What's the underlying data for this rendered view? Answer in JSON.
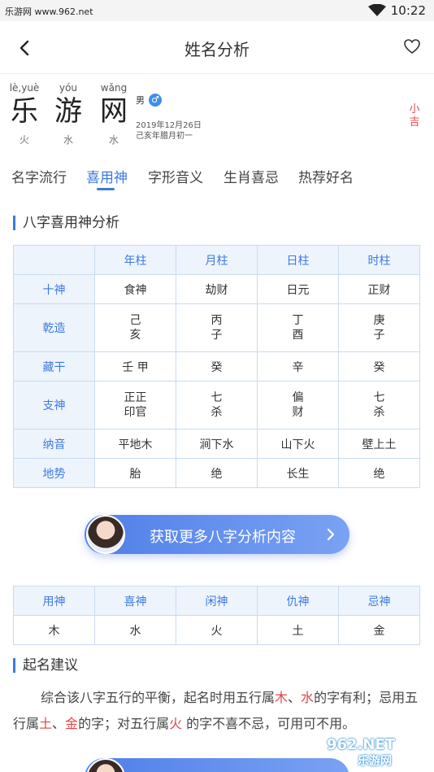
{
  "status_bar": {
    "site": "乐游网 www.962.net",
    "time": "10:22"
  },
  "nav": {
    "title": "姓名分析"
  },
  "name": {
    "chars": [
      {
        "pinyin": "lè,yuè",
        "char": "乐",
        "element": "火"
      },
      {
        "pinyin": "yóu",
        "char": "游",
        "element": "水"
      },
      {
        "pinyin": "wǎng",
        "char": "网",
        "element": "水"
      }
    ],
    "gender": "男",
    "gender_icon": "♂",
    "date_solar": "2019年12月26日",
    "date_lunar": "己亥年腊月初一",
    "luck": "小吉"
  },
  "tabs": [
    {
      "label": "名字流行",
      "active": false
    },
    {
      "label": "喜用神",
      "active": true
    },
    {
      "label": "字形音义",
      "active": false
    },
    {
      "label": "生肖喜忌",
      "active": false
    },
    {
      "label": "热荐好名",
      "active": false
    }
  ],
  "bazi": {
    "section_title": "八字喜用神分析",
    "columns": [
      "",
      "年柱",
      "月柱",
      "日柱",
      "时柱"
    ],
    "rows": [
      {
        "label": "十神",
        "cells": [
          "食神",
          "劫财",
          "日元",
          "正财"
        ]
      },
      {
        "label": "乾造",
        "cells": [
          "己\n亥",
          "丙\n子",
          "丁\n酉",
          "庚\n子"
        ]
      },
      {
        "label": "藏干",
        "cells": [
          "壬 甲",
          "癸",
          "辛",
          "癸"
        ]
      },
      {
        "label": "支神",
        "cells": [
          "正正\n印官",
          "七\n杀",
          "偏\n财",
          "七\n杀"
        ]
      },
      {
        "label": "纳音",
        "cells": [
          "平地木",
          "涧下水",
          "山下火",
          "壁上土"
        ]
      },
      {
        "label": "地势",
        "cells": [
          "胎",
          "绝",
          "长生",
          "绝"
        ]
      }
    ]
  },
  "cta": {
    "label": "获取更多八字分析内容"
  },
  "gods": {
    "headers": [
      "用神",
      "喜神",
      "闲神",
      "仇神",
      "忌神"
    ],
    "values": [
      "木",
      "水",
      "火",
      "土",
      "金"
    ]
  },
  "advice": {
    "section_title": "起名建议",
    "parts": [
      {
        "text": "综合该八字五行的平衡，起名时用五行属",
        "red": false
      },
      {
        "text": "木",
        "red": true
      },
      {
        "text": "、",
        "red": false
      },
      {
        "text": "水",
        "red": true
      },
      {
        "text": "的字有利；忌用五行属",
        "red": false
      },
      {
        "text": "土",
        "red": true
      },
      {
        "text": "、",
        "red": false
      },
      {
        "text": "金",
        "red": true
      },
      {
        "text": "的字；对五行属",
        "red": false
      },
      {
        "text": "火",
        "red": true
      },
      {
        "text": " 的字不喜不忌，可用可不用。",
        "red": false
      }
    ]
  },
  "watermark": {
    "top": "962.NET",
    "bottom": "乐游网"
  },
  "colors": {
    "accent": "#3d7ae0",
    "red": "#e2464a",
    "table_border": "#c8dbf2",
    "table_header_bg": "#eef4fc"
  }
}
